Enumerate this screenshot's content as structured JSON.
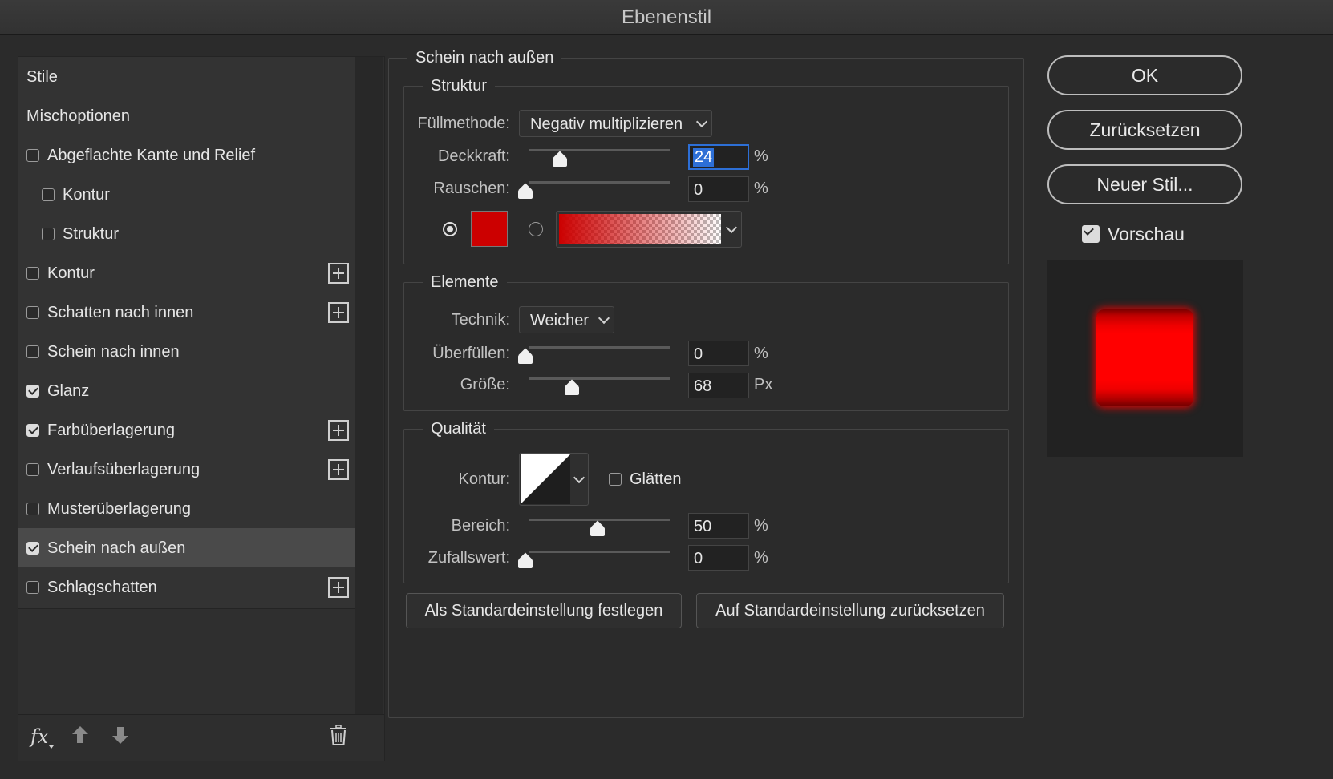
{
  "window": {
    "title": "Ebenenstil"
  },
  "styles_list": {
    "items": [
      {
        "label": "Stile",
        "checkbox": false,
        "checked": false,
        "indent": false,
        "plus": false,
        "selected": false
      },
      {
        "label": "Mischoptionen",
        "checkbox": false,
        "checked": false,
        "indent": false,
        "plus": false,
        "selected": false
      },
      {
        "label": "Abgeflachte Kante und Relief",
        "checkbox": true,
        "checked": false,
        "indent": false,
        "plus": false,
        "selected": false
      },
      {
        "label": "Kontur",
        "checkbox": true,
        "checked": false,
        "indent": true,
        "plus": false,
        "selected": false
      },
      {
        "label": "Struktur",
        "checkbox": true,
        "checked": false,
        "indent": true,
        "plus": false,
        "selected": false
      },
      {
        "label": "Kontur",
        "checkbox": true,
        "checked": false,
        "indent": false,
        "plus": true,
        "selected": false
      },
      {
        "label": "Schatten nach innen",
        "checkbox": true,
        "checked": false,
        "indent": false,
        "plus": true,
        "selected": false
      },
      {
        "label": "Schein nach innen",
        "checkbox": true,
        "checked": false,
        "indent": false,
        "plus": false,
        "selected": false
      },
      {
        "label": "Glanz",
        "checkbox": true,
        "checked": true,
        "indent": false,
        "plus": false,
        "selected": false
      },
      {
        "label": "Farbüberlagerung",
        "checkbox": true,
        "checked": true,
        "indent": false,
        "plus": true,
        "selected": false
      },
      {
        "label": "Verlaufsüberlagerung",
        "checkbox": true,
        "checked": false,
        "indent": false,
        "plus": true,
        "selected": false
      },
      {
        "label": "Musterüberlagerung",
        "checkbox": true,
        "checked": false,
        "indent": false,
        "plus": false,
        "selected": false
      },
      {
        "label": "Schein nach außen",
        "checkbox": true,
        "checked": true,
        "indent": false,
        "plus": false,
        "selected": true
      },
      {
        "label": "Schlagschatten",
        "checkbox": true,
        "checked": false,
        "indent": false,
        "plus": true,
        "selected": false
      }
    ],
    "footer": {
      "fx_label": "fx"
    }
  },
  "panel": {
    "title": "Schein nach außen",
    "struktur": {
      "title": "Struktur",
      "fill_label": "Füllmethode:",
      "fill_value": "Negativ multiplizieren",
      "opacity_label": "Deckkraft:",
      "opacity_value": "24",
      "opacity_unit": "%",
      "opacity_level": 0.24,
      "noise_label": "Rauschen:",
      "noise_value": "0",
      "noise_unit": "%",
      "noise_level": 0,
      "glow_color": "#cc0000"
    },
    "elemente": {
      "title": "Elemente",
      "technique_label": "Technik:",
      "technique_value": "Weicher",
      "spread_label": "Überfüllen:",
      "spread_value": "0",
      "spread_unit": "%",
      "spread_level": 0,
      "size_label": "Größe:",
      "size_value": "68",
      "size_unit": "Px",
      "size_level": 0.27
    },
    "qualitaet": {
      "title": "Qualität",
      "contour_label": "Kontur:",
      "antialias_label": "Glätten",
      "antialias_checked": false,
      "range_label": "Bereich:",
      "range_value": "50",
      "range_unit": "%",
      "range_level": 0.5,
      "jitter_label": "Zufallswert:",
      "jitter_value": "0",
      "jitter_unit": "%",
      "jitter_level": 0
    },
    "make_default": "Als Standardeinstellung festlegen",
    "reset_default": "Auf Standardeinstellung zurücksetzen"
  },
  "actions": {
    "ok": "OK",
    "reset": "Zurücksetzen",
    "new_style": "Neuer Stil...",
    "preview_label": "Vorschau",
    "preview_checked": true
  },
  "colors": {
    "accent": "#2d6fd6",
    "glow": "#ff0000"
  }
}
